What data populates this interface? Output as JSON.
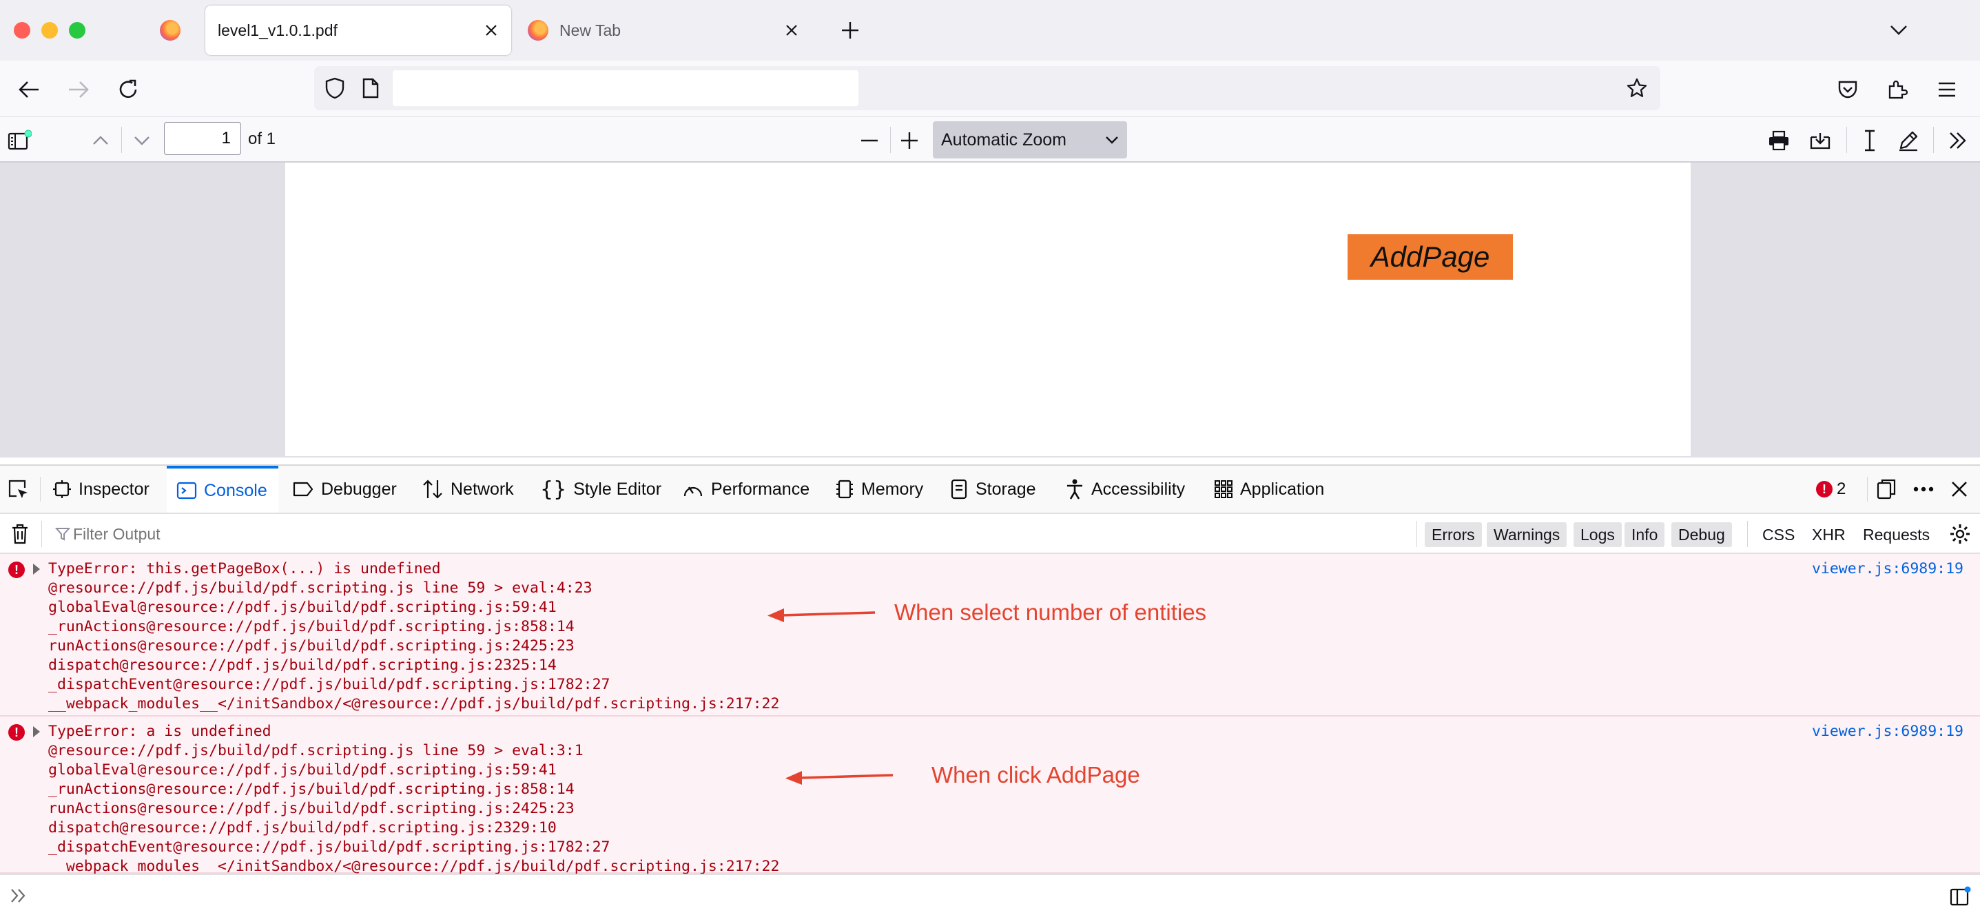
{
  "browser": {
    "tabs": [
      {
        "title": "level1_v1.0.1.pdf",
        "active": true
      },
      {
        "title": "New Tab",
        "active": false
      }
    ],
    "url": ""
  },
  "pdf_toolbar": {
    "page_number": "1",
    "page_count_label": "of 1",
    "zoom_label": "Automatic Zoom"
  },
  "pdf_page": {
    "button_label": "AddPage",
    "button_color": "#f07b2e"
  },
  "devtools": {
    "tabs": [
      "Inspector",
      "Console",
      "Debugger",
      "Network",
      "Style Editor",
      "Performance",
      "Memory",
      "Storage",
      "Accessibility",
      "Application"
    ],
    "selected_tab": "Console",
    "error_count": "2",
    "filter_placeholder": "Filter Output",
    "filter_buttons": [
      "Errors",
      "Warnings",
      "Logs",
      "Info",
      "Debug"
    ],
    "request_filters": [
      "CSS",
      "XHR",
      "Requests"
    ],
    "messages": [
      {
        "lines": [
          "TypeError: this.getPageBox(...) is undefined",
          "@resource://pdf.js/build/pdf.scripting.js line 59 > eval:4:23",
          "globalEval@resource://pdf.js/build/pdf.scripting.js:59:41",
          "_runActions@resource://pdf.js/build/pdf.scripting.js:858:14",
          "runActions@resource://pdf.js/build/pdf.scripting.js:2425:23",
          "dispatch@resource://pdf.js/build/pdf.scripting.js:2325:14",
          "_dispatchEvent@resource://pdf.js/build/pdf.scripting.js:1782:27",
          "__webpack_modules__</initSandbox/<@resource://pdf.js/build/pdf.scripting.js:217:22"
        ],
        "location": "viewer.js:6989:19",
        "annotation": "When select number of entities"
      },
      {
        "lines": [
          "TypeError: a is undefined",
          "@resource://pdf.js/build/pdf.scripting.js line 59 > eval:3:1",
          "globalEval@resource://pdf.js/build/pdf.scripting.js:59:41",
          "_runActions@resource://pdf.js/build/pdf.scripting.js:858:14",
          "runActions@resource://pdf.js/build/pdf.scripting.js:2425:23",
          "dispatch@resource://pdf.js/build/pdf.scripting.js:2329:10",
          "_dispatchEvent@resource://pdf.js/build/pdf.scripting.js:1782:27",
          "__webpack_modules__</initSandbox/<@resource://pdf.js/build/pdf.scripting.js:217:22"
        ],
        "location": "viewer.js:6989:19",
        "annotation": "When click AddPage"
      }
    ]
  },
  "colors": {
    "error_text": "#a4000f",
    "annotation": "#e4442f",
    "accent": "#0060df"
  }
}
